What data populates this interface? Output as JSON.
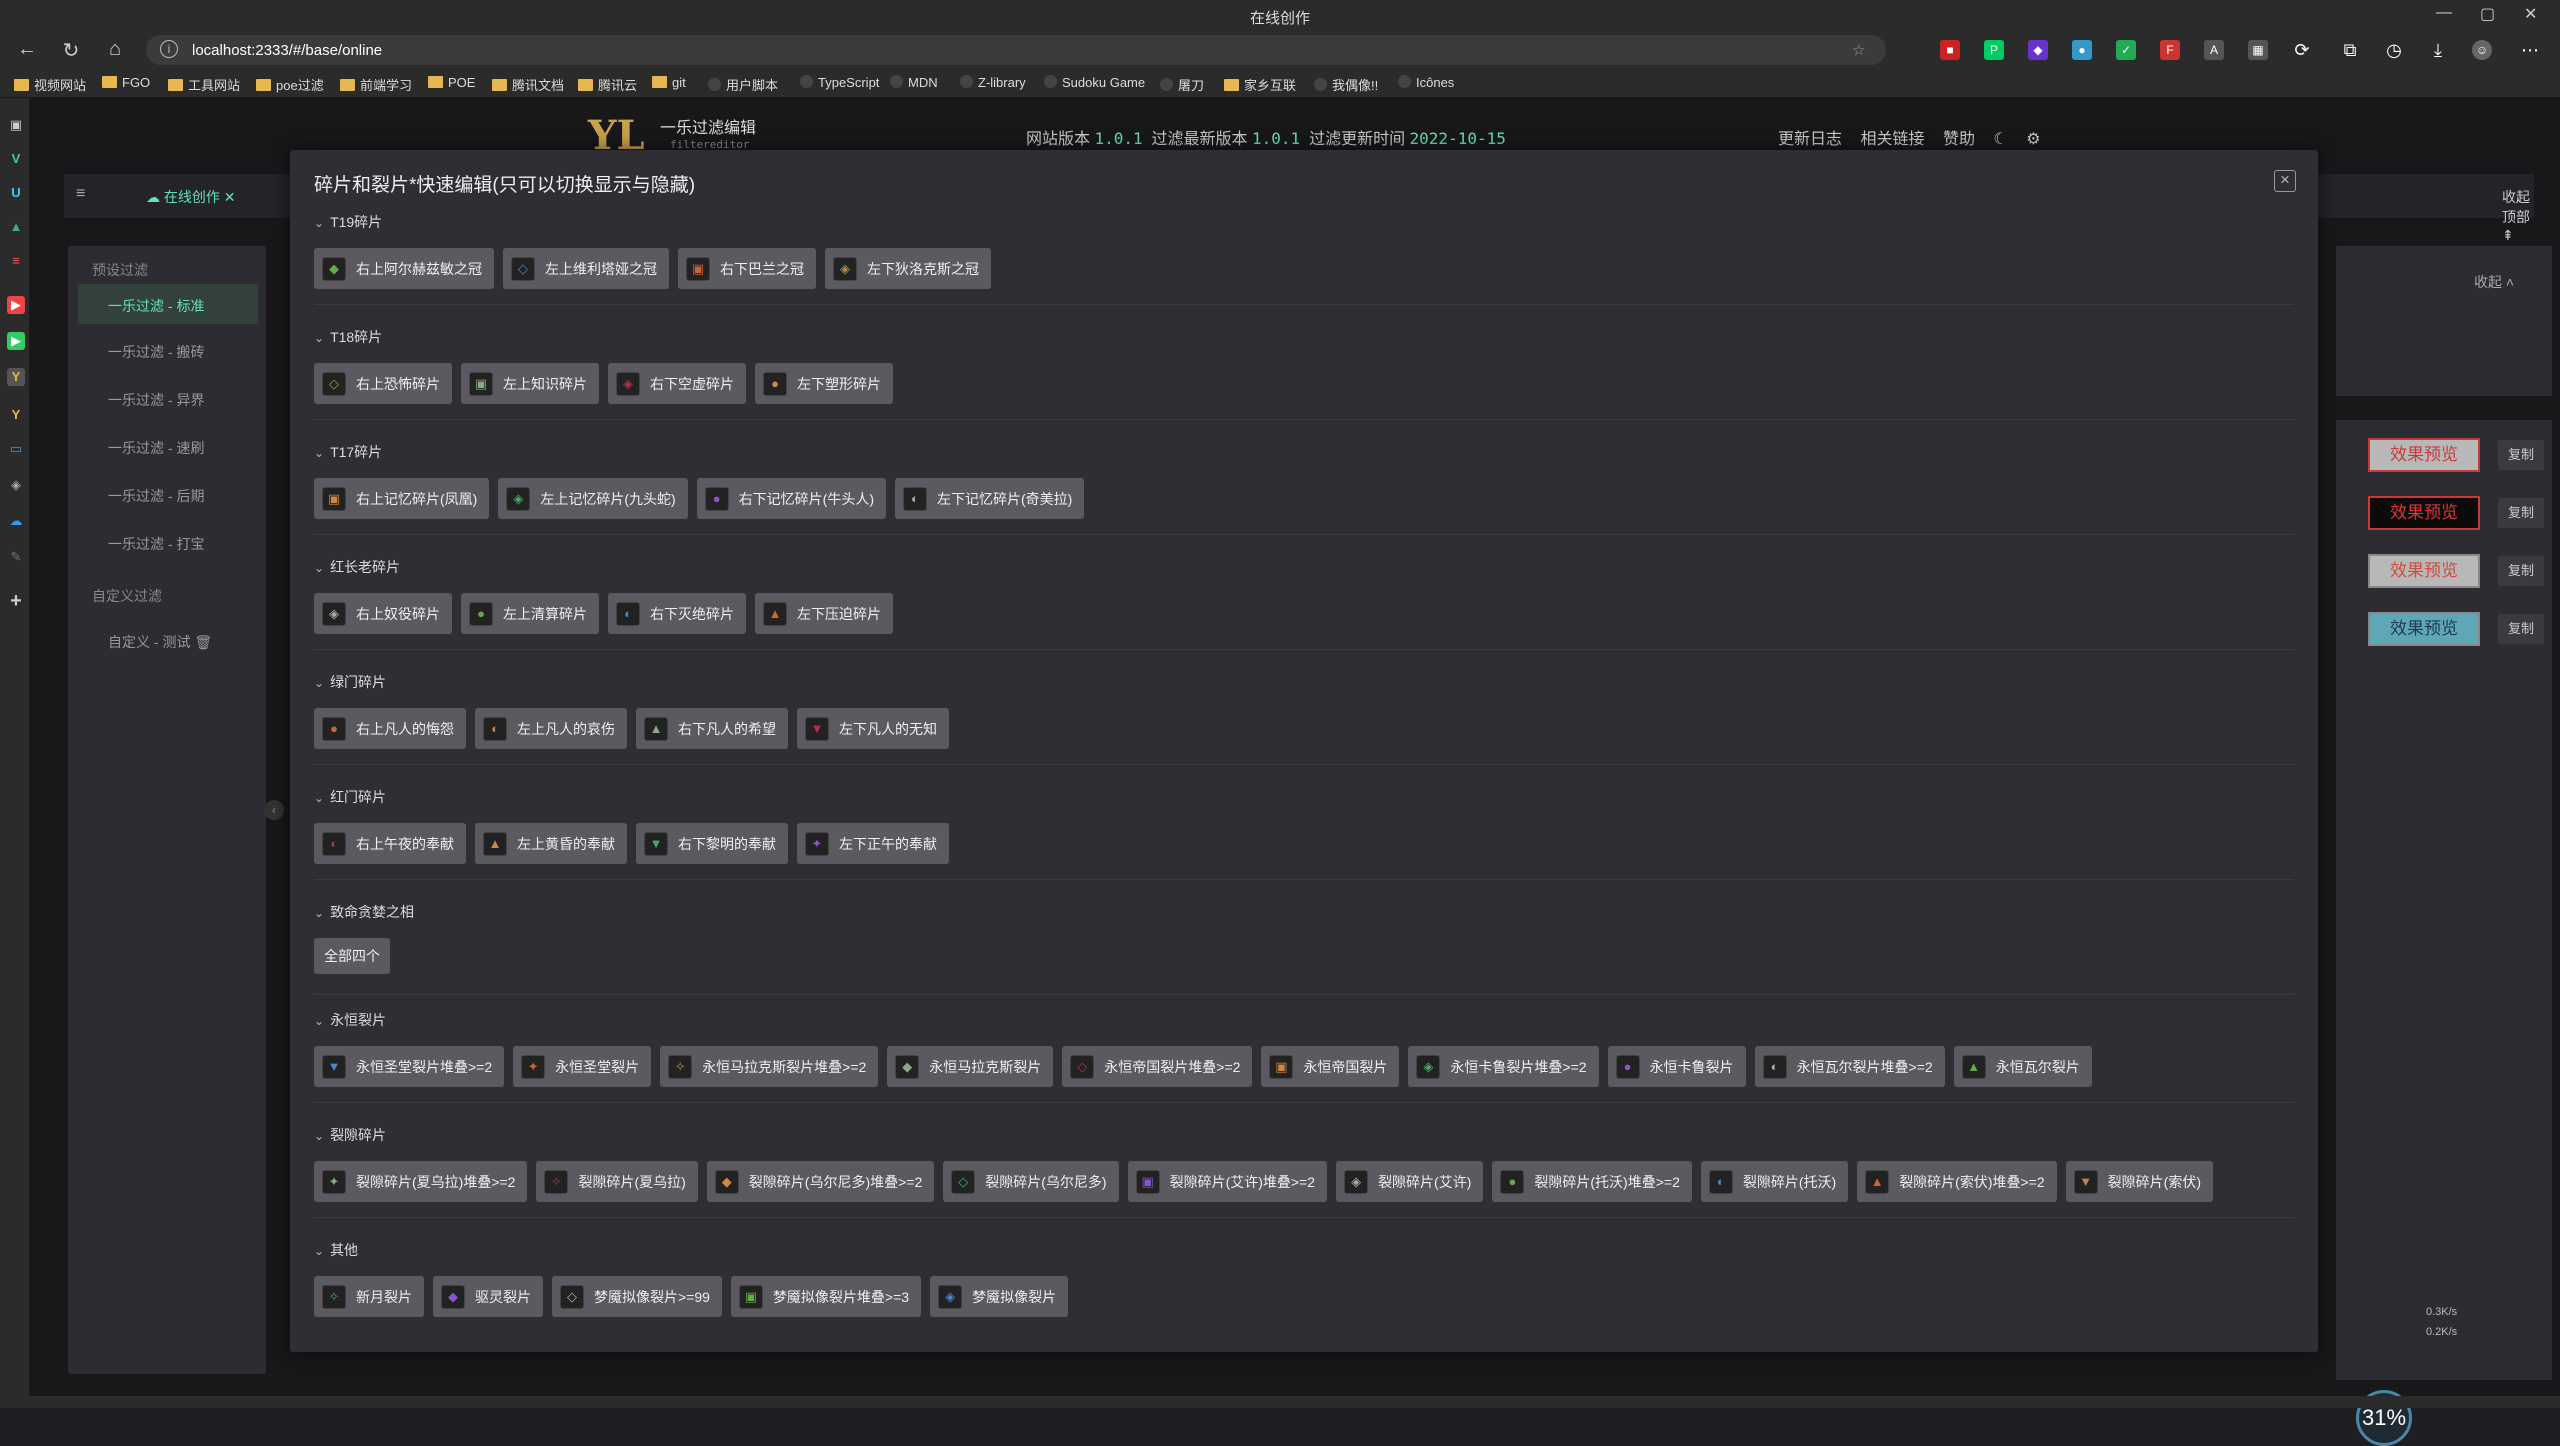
{
  "window": {
    "title": "在线创作",
    "min": "—",
    "max": "▢",
    "close": "✕"
  },
  "nav": {
    "url": "localhost:2333/#/base/online"
  },
  "bookmarks": [
    "视频网站",
    "FGO",
    "工具网站",
    "poe过滤",
    "前端学习",
    "POE",
    "腾讯文档",
    "腾讯云",
    "git",
    "用户脚本",
    "TypeScript",
    "MDN",
    "Z-library",
    "Sudoku Game",
    "屠刀",
    "家乡互联",
    "我偶像!!",
    "Icônes"
  ],
  "header": {
    "logo": "YL",
    "title": "一乐过滤编辑",
    "subtitle": "filtereditor",
    "site_version_label": "网站版本",
    "site_version": "1.0.1",
    "filter_latest_label": "过滤最新版本",
    "filter_latest": "1.0.1",
    "filter_update_label": "过滤更新时间",
    "filter_update": "2022-10-15",
    "links": [
      "更新日志",
      "相关链接",
      "赞助"
    ]
  },
  "tabs": {
    "active": "在线创作",
    "collapse_top": "收起顶部"
  },
  "left": {
    "preset_head": "预设过滤",
    "items": [
      "一乐过滤 - 标准",
      "一乐过滤 - 搬砖",
      "一乐过滤 - 异界",
      "一乐过滤 - 速刷",
      "一乐过滤 - 后期",
      "一乐过滤 - 打宝"
    ],
    "custom_head": "自定义过滤",
    "custom_item": "自定义 - 测试"
  },
  "right": {
    "collapse": "收起",
    "preview": "效果预览",
    "copy": "复制",
    "preview_styles": [
      {
        "bg": "#b8b8b8",
        "fg": "#c83a3a",
        "border": "#c83a3a"
      },
      {
        "bg": "#0b0b0b",
        "fg": "#e0333a",
        "border": "#c83a3a"
      },
      {
        "bg": "#b8b8b8",
        "fg": "#d14a3a",
        "border": "#888"
      },
      {
        "bg": "#5fa6b7",
        "fg": "#1c3a55",
        "border": "#888"
      }
    ]
  },
  "modal": {
    "title": "碎片和裂片*快速编辑(只可以切换显示与隐藏)",
    "sections": [
      {
        "name": "T19碎片",
        "items": [
          "右上阿尔赫兹敏之冠",
          "左上维利塔娅之冠",
          "右下巴兰之冠",
          "左下狄洛克斯之冠"
        ]
      },
      {
        "name": "T18碎片",
        "items": [
          "右上恐怖碎片",
          "左上知识碎片",
          "右下空虚碎片",
          "左下塑形碎片"
        ]
      },
      {
        "name": "T17碎片",
        "items": [
          "右上记忆碎片(凤凰)",
          "左上记忆碎片(九头蛇)",
          "右下记忆碎片(牛头人)",
          "左下记忆碎片(奇美拉)"
        ]
      },
      {
        "name": "红长老碎片",
        "items": [
          "右上奴役碎片",
          "左上清算碎片",
          "右下灭绝碎片",
          "左下压迫碎片"
        ]
      },
      {
        "name": "绿门碎片",
        "items": [
          "右上凡人的悔怨",
          "左上凡人的哀伤",
          "右下凡人的希望",
          "左下凡人的无知"
        ]
      },
      {
        "name": "红门碎片",
        "items": [
          "右上午夜的奉献",
          "左上黄昏的奉献",
          "右下黎明的奉献",
          "左下正午的奉献"
        ]
      },
      {
        "name": "致命贪婪之相",
        "items": [
          "全部四个"
        ],
        "plain": true
      },
      {
        "name": "永恒裂片",
        "items": [
          "永恒圣堂裂片堆叠>=2",
          "永恒圣堂裂片",
          "永恒马拉克斯裂片堆叠>=2",
          "永恒马拉克斯裂片",
          "永恒帝国裂片堆叠>=2",
          "永恒帝国裂片",
          "永恒卡鲁裂片堆叠>=2",
          "永恒卡鲁裂片",
          "永恒瓦尔裂片堆叠>=2",
          "永恒瓦尔裂片"
        ]
      },
      {
        "name": "裂隙碎片",
        "items": [
          "裂隙碎片(夏乌拉)堆叠>=2",
          "裂隙碎片(夏乌拉)",
          "裂隙碎片(乌尔尼多)堆叠>=2",
          "裂隙碎片(乌尔尼多)",
          "裂隙碎片(艾许)堆叠>=2",
          "裂隙碎片(艾许)",
          "裂隙碎片(托沃)堆叠>=2",
          "裂隙碎片(托沃)",
          "裂隙碎片(索伏)堆叠>=2",
          "裂隙碎片(索伏)"
        ]
      },
      {
        "name": "其他",
        "items": [
          "新月裂片",
          "驱灵裂片",
          "梦魇拟像裂片>=99",
          "梦魇拟像裂片堆叠>=3",
          "梦魇拟像裂片"
        ]
      }
    ]
  },
  "net": {
    "percent": "31%",
    "up": "0.3K/s",
    "down": "0.2K/s"
  }
}
